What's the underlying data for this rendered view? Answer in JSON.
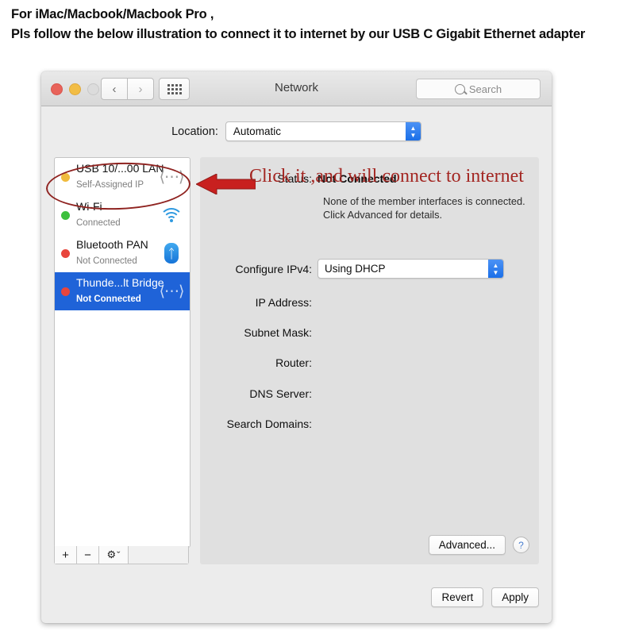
{
  "instructions": {
    "line1": "For iMac/Macbook/Macbook Pro ,",
    "line2": "Pls follow the below illustration to connect it to internet by our USB C Gigabit Ethernet adapter"
  },
  "window": {
    "title": "Network",
    "traffic_lights": {
      "close": "close-button",
      "minimize": "minimize-button",
      "zoom": "zoom-button"
    },
    "nav": {
      "back": "‹",
      "forward": "›",
      "grid": "show-all-button"
    },
    "search": {
      "placeholder": "Search"
    }
  },
  "location": {
    "label": "Location:",
    "value": "Automatic"
  },
  "sidebar": {
    "services": [
      {
        "name": "USB 10/...00 LAN",
        "state": "Self-Assigned IP",
        "dot": "yellow",
        "icon": "ethernet-icon",
        "selected": false
      },
      {
        "name": "Wi-Fi",
        "state": "Connected",
        "dot": "green",
        "icon": "wifi-icon",
        "selected": false
      },
      {
        "name": "Bluetooth PAN",
        "state": "Not Connected",
        "dot": "red",
        "icon": "bluetooth-icon",
        "selected": false
      },
      {
        "name": "Thunde...lt Bridge",
        "state": "Not Connected",
        "dot": "red",
        "icon": "ethernet-icon",
        "selected": true
      }
    ],
    "toolbar": {
      "add": "+",
      "remove": "−",
      "gear": "⚙",
      "gear_chevron": "ˇ"
    }
  },
  "content": {
    "status_label": "Status:",
    "status_value": "Not Connected",
    "status_desc_line1": "None of the member interfaces is connected.",
    "status_desc_line2": "Click Advanced for details.",
    "fields": [
      {
        "label": "Configure IPv4:",
        "value": "Using DHCP",
        "type": "popup"
      },
      {
        "label": "IP Address:",
        "value": "",
        "type": "text"
      },
      {
        "label": "Subnet Mask:",
        "value": "",
        "type": "text"
      },
      {
        "label": "Router:",
        "value": "",
        "type": "text"
      },
      {
        "label": "DNS Server:",
        "value": "",
        "type": "text"
      },
      {
        "label": "Search Domains:",
        "value": "",
        "type": "text"
      }
    ],
    "advanced_label": "Advanced...",
    "help_label": "?"
  },
  "footer": {
    "revert_label": "Revert",
    "apply_label": "Apply"
  },
  "annotations": {
    "callout_text": "Click  it ,and will connect to internet",
    "oval_color": "#8f2320",
    "arrow_color": "#c8201f",
    "text_color": "#a32622"
  }
}
